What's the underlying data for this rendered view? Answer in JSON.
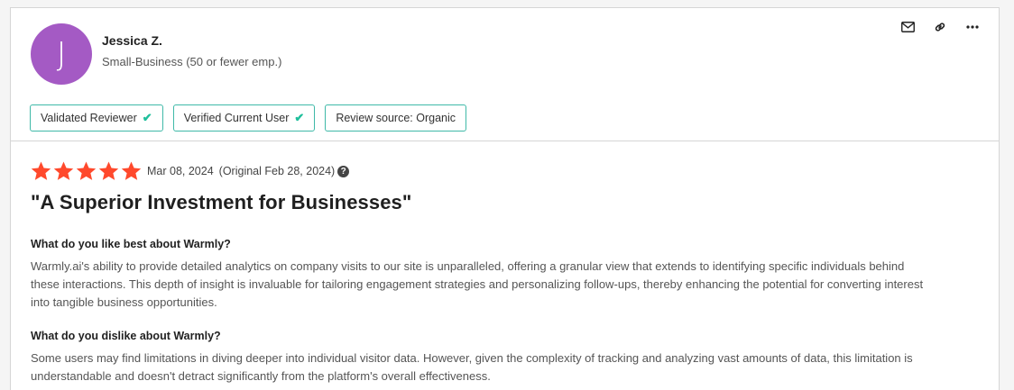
{
  "reviewer": {
    "initial": "J",
    "name": "Jessica Z.",
    "segment": "Small-Business (50 or fewer emp.)",
    "avatar_color": "#a45ac4"
  },
  "actions": [
    "mail-icon",
    "link-icon",
    "more-icon"
  ],
  "badges": [
    {
      "label": "Validated Reviewer",
      "check": "✔"
    },
    {
      "label": "Verified Current User",
      "check": "✔"
    },
    {
      "label": "Review source: Organic"
    }
  ],
  "review": {
    "rating": 5,
    "star_color": "#ff492c",
    "date": "Mar 08, 2024",
    "original_date": "(Original Feb 28, 2024)",
    "help_icon": "?",
    "title": "\"A Superior Investment for Businesses\"",
    "questions": [
      {
        "question": "What do you like best about Warmly?",
        "answer": "Warmly.ai's ability to provide detailed analytics on company visits to our site is unparalleled, offering a granular view that extends to identifying specific individuals behind these interactions. This depth of insight is invaluable for tailoring engagement strategies and personalizing follow-ups, thereby enhancing the potential for converting interest into tangible business opportunities."
      },
      {
        "question": "What do you dislike about Warmly?",
        "answer": "Some users may find limitations in diving deeper into individual visitor data. However, given the complexity of tracking and analyzing vast amounts of data, this limitation is understandable and doesn't detract significantly from the platform's overall effectiveness."
      }
    ]
  },
  "colors": {
    "badge_border": "#3fb9a8",
    "check": "#1fbf9c"
  }
}
